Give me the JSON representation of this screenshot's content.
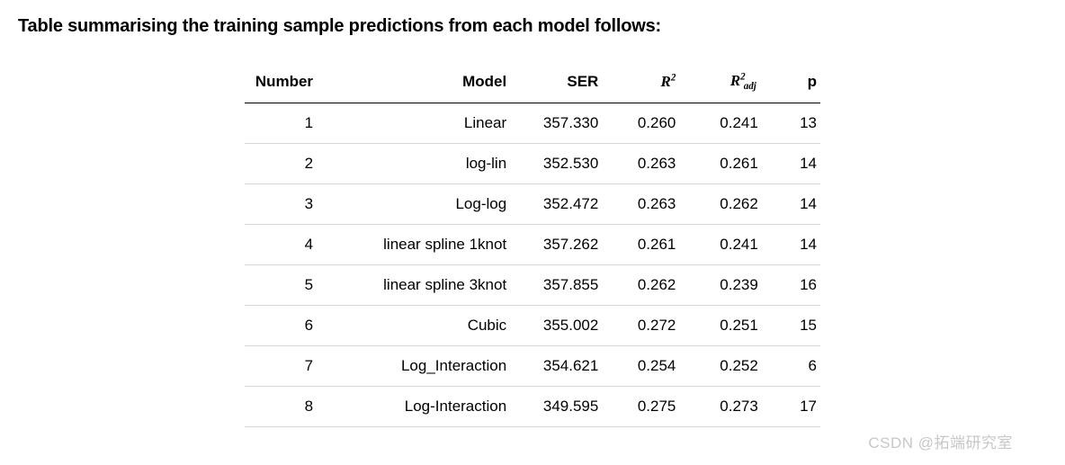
{
  "title": "Table summarising the training sample predictions from each model follows:",
  "table": {
    "headers": {
      "number": "Number",
      "model": "Model",
      "ser": "SER",
      "p": "p"
    },
    "rows": [
      {
        "number": "1",
        "model": "Linear",
        "ser": "357.330",
        "r2": "0.260",
        "r2adj": "0.241",
        "p": "13"
      },
      {
        "number": "2",
        "model": "log-lin",
        "ser": "352.530",
        "r2": "0.263",
        "r2adj": "0.261",
        "p": "14"
      },
      {
        "number": "3",
        "model": "Log-log",
        "ser": "352.472",
        "r2": "0.263",
        "r2adj": "0.262",
        "p": "14"
      },
      {
        "number": "4",
        "model": "linear spline 1knot",
        "ser": "357.262",
        "r2": "0.261",
        "r2adj": "0.241",
        "p": "14"
      },
      {
        "number": "5",
        "model": "linear spline 3knot",
        "ser": "357.855",
        "r2": "0.262",
        "r2adj": "0.239",
        "p": "16"
      },
      {
        "number": "6",
        "model": "Cubic",
        "ser": "355.002",
        "r2": "0.272",
        "r2adj": "0.251",
        "p": "15"
      },
      {
        "number": "7",
        "model": "Log_Interaction",
        "ser": "354.621",
        "r2": "0.254",
        "r2adj": "0.252",
        "p": "6"
      },
      {
        "number": "8",
        "model": "Log-Interaction",
        "ser": "349.595",
        "r2": "0.275",
        "r2adj": "0.273",
        "p": "17"
      }
    ]
  },
  "watermark": "CSDN @拓端研究室",
  "chart_data": {
    "type": "table",
    "title": "Table summarising the training sample predictions from each model follows:",
    "columns": [
      "Number",
      "Model",
      "SER",
      "R^2",
      "R^2_adj",
      "p"
    ],
    "rows": [
      [
        1,
        "Linear",
        357.33,
        0.26,
        0.241,
        13
      ],
      [
        2,
        "log-lin",
        352.53,
        0.263,
        0.261,
        14
      ],
      [
        3,
        "Log-log",
        352.472,
        0.263,
        0.262,
        14
      ],
      [
        4,
        "linear spline 1knot",
        357.262,
        0.261,
        0.241,
        14
      ],
      [
        5,
        "linear spline 3knot",
        357.855,
        0.262,
        0.239,
        16
      ],
      [
        6,
        "Cubic",
        355.002,
        0.272,
        0.251,
        15
      ],
      [
        7,
        "Log_Interaction",
        354.621,
        0.254,
        0.252,
        6
      ],
      [
        8,
        "Log-Interaction",
        349.595,
        0.275,
        0.273,
        17
      ]
    ]
  }
}
